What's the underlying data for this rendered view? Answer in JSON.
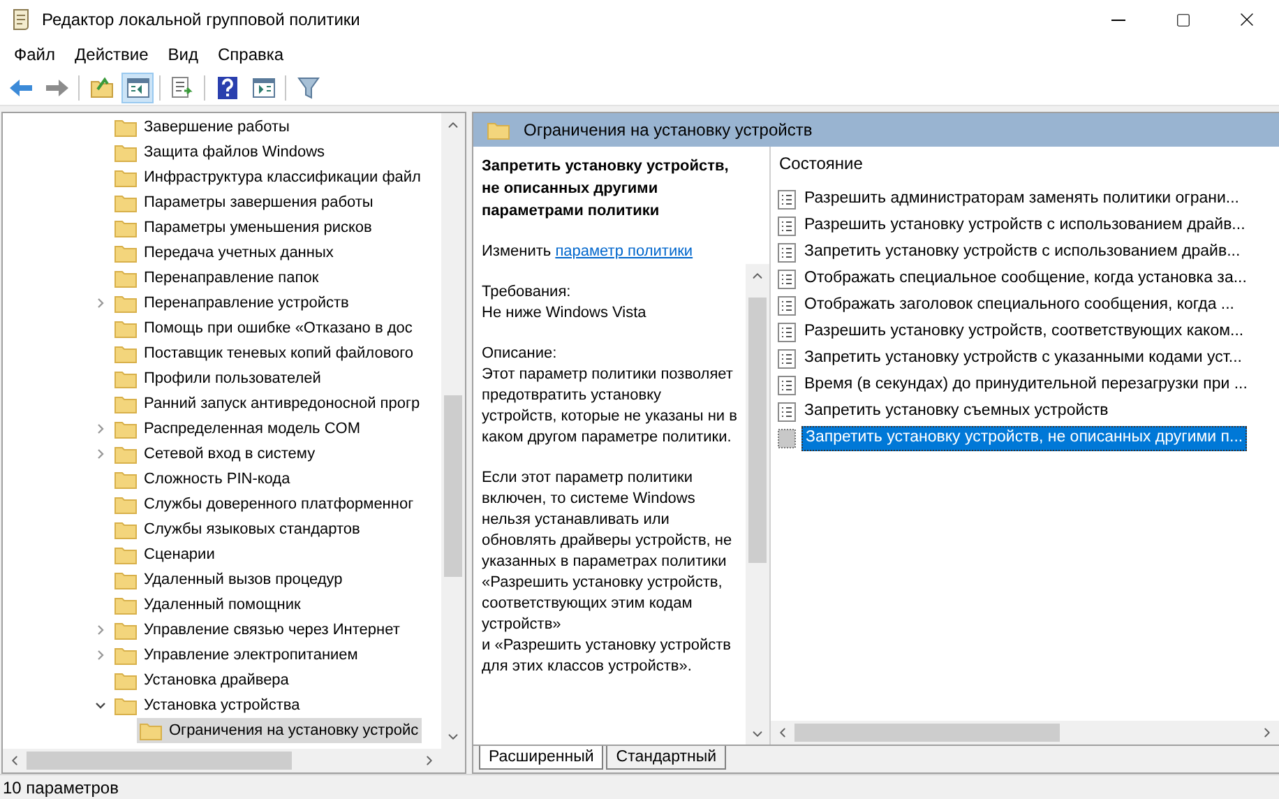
{
  "window": {
    "title": "Редактор локальной групповой политики"
  },
  "menu": [
    "Файл",
    "Действие",
    "Вид",
    "Справка"
  ],
  "toolbar": [
    {
      "kind": "back",
      "pressed": false
    },
    {
      "kind": "forward",
      "pressed": false
    },
    {
      "kind": "up",
      "pressed": false
    },
    {
      "kind": "tree",
      "pressed": true
    },
    {
      "kind": "export",
      "pressed": false
    },
    {
      "kind": "help",
      "pressed": false
    },
    {
      "kind": "actions",
      "pressed": false
    },
    {
      "kind": "filter",
      "pressed": false
    }
  ],
  "tree": [
    {
      "label": "Завершение работы",
      "expandable": false,
      "selected": false
    },
    {
      "label": "Защита файлов Windows",
      "expandable": false,
      "selected": false
    },
    {
      "label": "Инфраструктура классификации файл",
      "expandable": false,
      "selected": false
    },
    {
      "label": "Параметры завершения работы",
      "expandable": false,
      "selected": false
    },
    {
      "label": "Параметры уменьшения рисков",
      "expandable": false,
      "selected": false
    },
    {
      "label": "Передача учетных данных",
      "expandable": false,
      "selected": false
    },
    {
      "label": "Перенаправление папок",
      "expandable": false,
      "selected": false
    },
    {
      "label": "Перенаправление устройств",
      "expandable": true,
      "expanded": false,
      "selected": false
    },
    {
      "label": "Помощь при ошибке «Отказано в дос",
      "expandable": false,
      "selected": false
    },
    {
      "label": "Поставщик теневых копий файлового",
      "expandable": false,
      "selected": false
    },
    {
      "label": "Профили пользователей",
      "expandable": false,
      "selected": false
    },
    {
      "label": "Ранний запуск антивредоносной прогр",
      "expandable": false,
      "selected": false
    },
    {
      "label": "Распределенная модель COM",
      "expandable": true,
      "expanded": false,
      "selected": false
    },
    {
      "label": "Сетевой вход в систему",
      "expandable": true,
      "expanded": false,
      "selected": false
    },
    {
      "label": "Сложность PIN-кода",
      "expandable": false,
      "selected": false
    },
    {
      "label": "Службы доверенного платформенног",
      "expandable": false,
      "selected": false
    },
    {
      "label": "Службы языковых стандартов",
      "expandable": false,
      "selected": false
    },
    {
      "label": "Сценарии",
      "expandable": false,
      "selected": false
    },
    {
      "label": "Удаленный вызов процедур",
      "expandable": false,
      "selected": false
    },
    {
      "label": "Удаленный помощник",
      "expandable": false,
      "selected": false
    },
    {
      "label": "Управление связью через Интернет",
      "expandable": true,
      "expanded": false,
      "selected": false
    },
    {
      "label": "Управление электропитанием",
      "expandable": true,
      "expanded": false,
      "selected": false
    },
    {
      "label": "Установка драйвера",
      "expandable": false,
      "selected": false
    },
    {
      "label": "Установка устройства",
      "expandable": true,
      "expanded": true,
      "selected": false,
      "children": [
        {
          "label": "Ограничения на установку устройс",
          "expandable": false,
          "selected": true
        }
      ]
    }
  ],
  "detail": {
    "header": "Ограничения на установку устройств",
    "policy_title": "Запретить установку устройств, не описанных другими параметрами политики",
    "edit_prefix": "Изменить",
    "edit_link": "параметр политики",
    "requirements_label": "Требования:",
    "requirements": "Не ниже Windows Vista",
    "description_label": "Описание:",
    "paragraphs": [
      "Этот параметр политики позволяет предотвратить установку устройств, которые не указаны ни в каком другом параметре политики.",
      "Если этот параметр политики включен, то системе Windows нельзя устанавливать или обновлять драйверы устройств, не указанных в параметрах политики «Разрешить установку устройств, соответствующих этим кодам устройств»",
      "и «Разрешить установку устройств для этих классов устройств»."
    ]
  },
  "column_header": "Состояние",
  "policies": [
    {
      "label": "Разрешить администраторам заменять политики ограни...",
      "selected": false
    },
    {
      "label": "Разрешить установку устройств с использованием драйв...",
      "selected": false
    },
    {
      "label": "Запретить установку устройств с использованием драйв...",
      "selected": false
    },
    {
      "label": "Отображать специальное сообщение, когда установка за...",
      "selected": false
    },
    {
      "label": "Отображать заголовок специального сообщения, когда ...",
      "selected": false
    },
    {
      "label": "Разрешить установку устройств, соответствующих каком...",
      "selected": false
    },
    {
      "label": "Запретить установку устройств с указанными кодами уст...",
      "selected": false
    },
    {
      "label": "Время (в секундах) до принудительной перезагрузки при ...",
      "selected": false
    },
    {
      "label": "Запретить установку съемных устройств",
      "selected": false
    },
    {
      "label": "Запретить установку устройств, не описанных другими п...",
      "selected": true
    }
  ],
  "view_tabs": [
    {
      "label": "Расширенный",
      "selected": true
    },
    {
      "label": "Стандартный",
      "selected": false
    }
  ],
  "status_bar": "10 параметров"
}
